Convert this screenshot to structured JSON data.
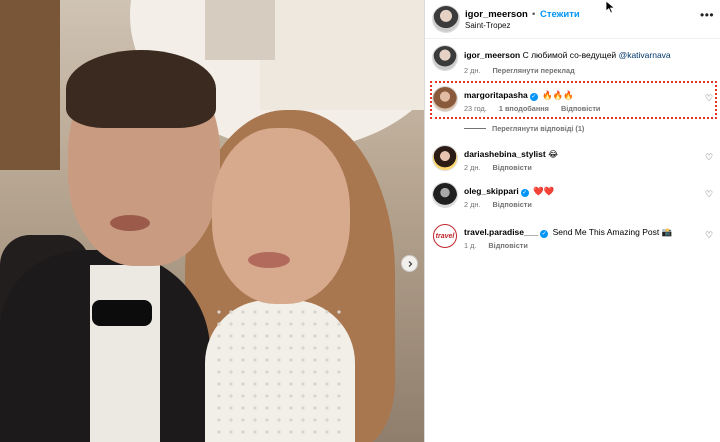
{
  "post": {
    "username": "igor_meerson",
    "separator": "•",
    "follow_label": "Стежити",
    "location": "Saint-Tropez",
    "more_icon": "more-horizontal-icon"
  },
  "caption": {
    "username": "igor_meerson",
    "text": "С любимой со-ведущей",
    "mention": "@kativarnava",
    "time": "2 дн.",
    "translate_label": "Переглянути переклад"
  },
  "comments": [
    {
      "username": "margoritapasha",
      "verified": true,
      "text": "🔥🔥🔥",
      "time": "23 год.",
      "likes": "1 вподобання",
      "reply_label": "Відповісти",
      "view_replies": "Переглянути відповіді (1)",
      "highlighted": true
    },
    {
      "username": "dariashebina_stylist",
      "verified": false,
      "text": "😂",
      "time": "2 дн.",
      "reply_label": "Відповісти"
    },
    {
      "username": "oleg_skippari",
      "verified": true,
      "text": "❤️❤️",
      "time": "2 дн.",
      "reply_label": "Відповісти"
    },
    {
      "username": "travel.paradise___",
      "verified": true,
      "text": "Send Me This Amazing Post 📸",
      "time": "1 д.",
      "reply_label": "Відповісти",
      "avatar_text": "travel"
    }
  ],
  "icons": {
    "heart": "heart-outline-icon",
    "verified": "verified-badge-icon",
    "next": "chevron-right-icon",
    "cursor": "mouse-pointer-icon"
  },
  "colors": {
    "accent": "#0095f6",
    "highlight_border": "#e2341f",
    "muted": "#737373"
  }
}
